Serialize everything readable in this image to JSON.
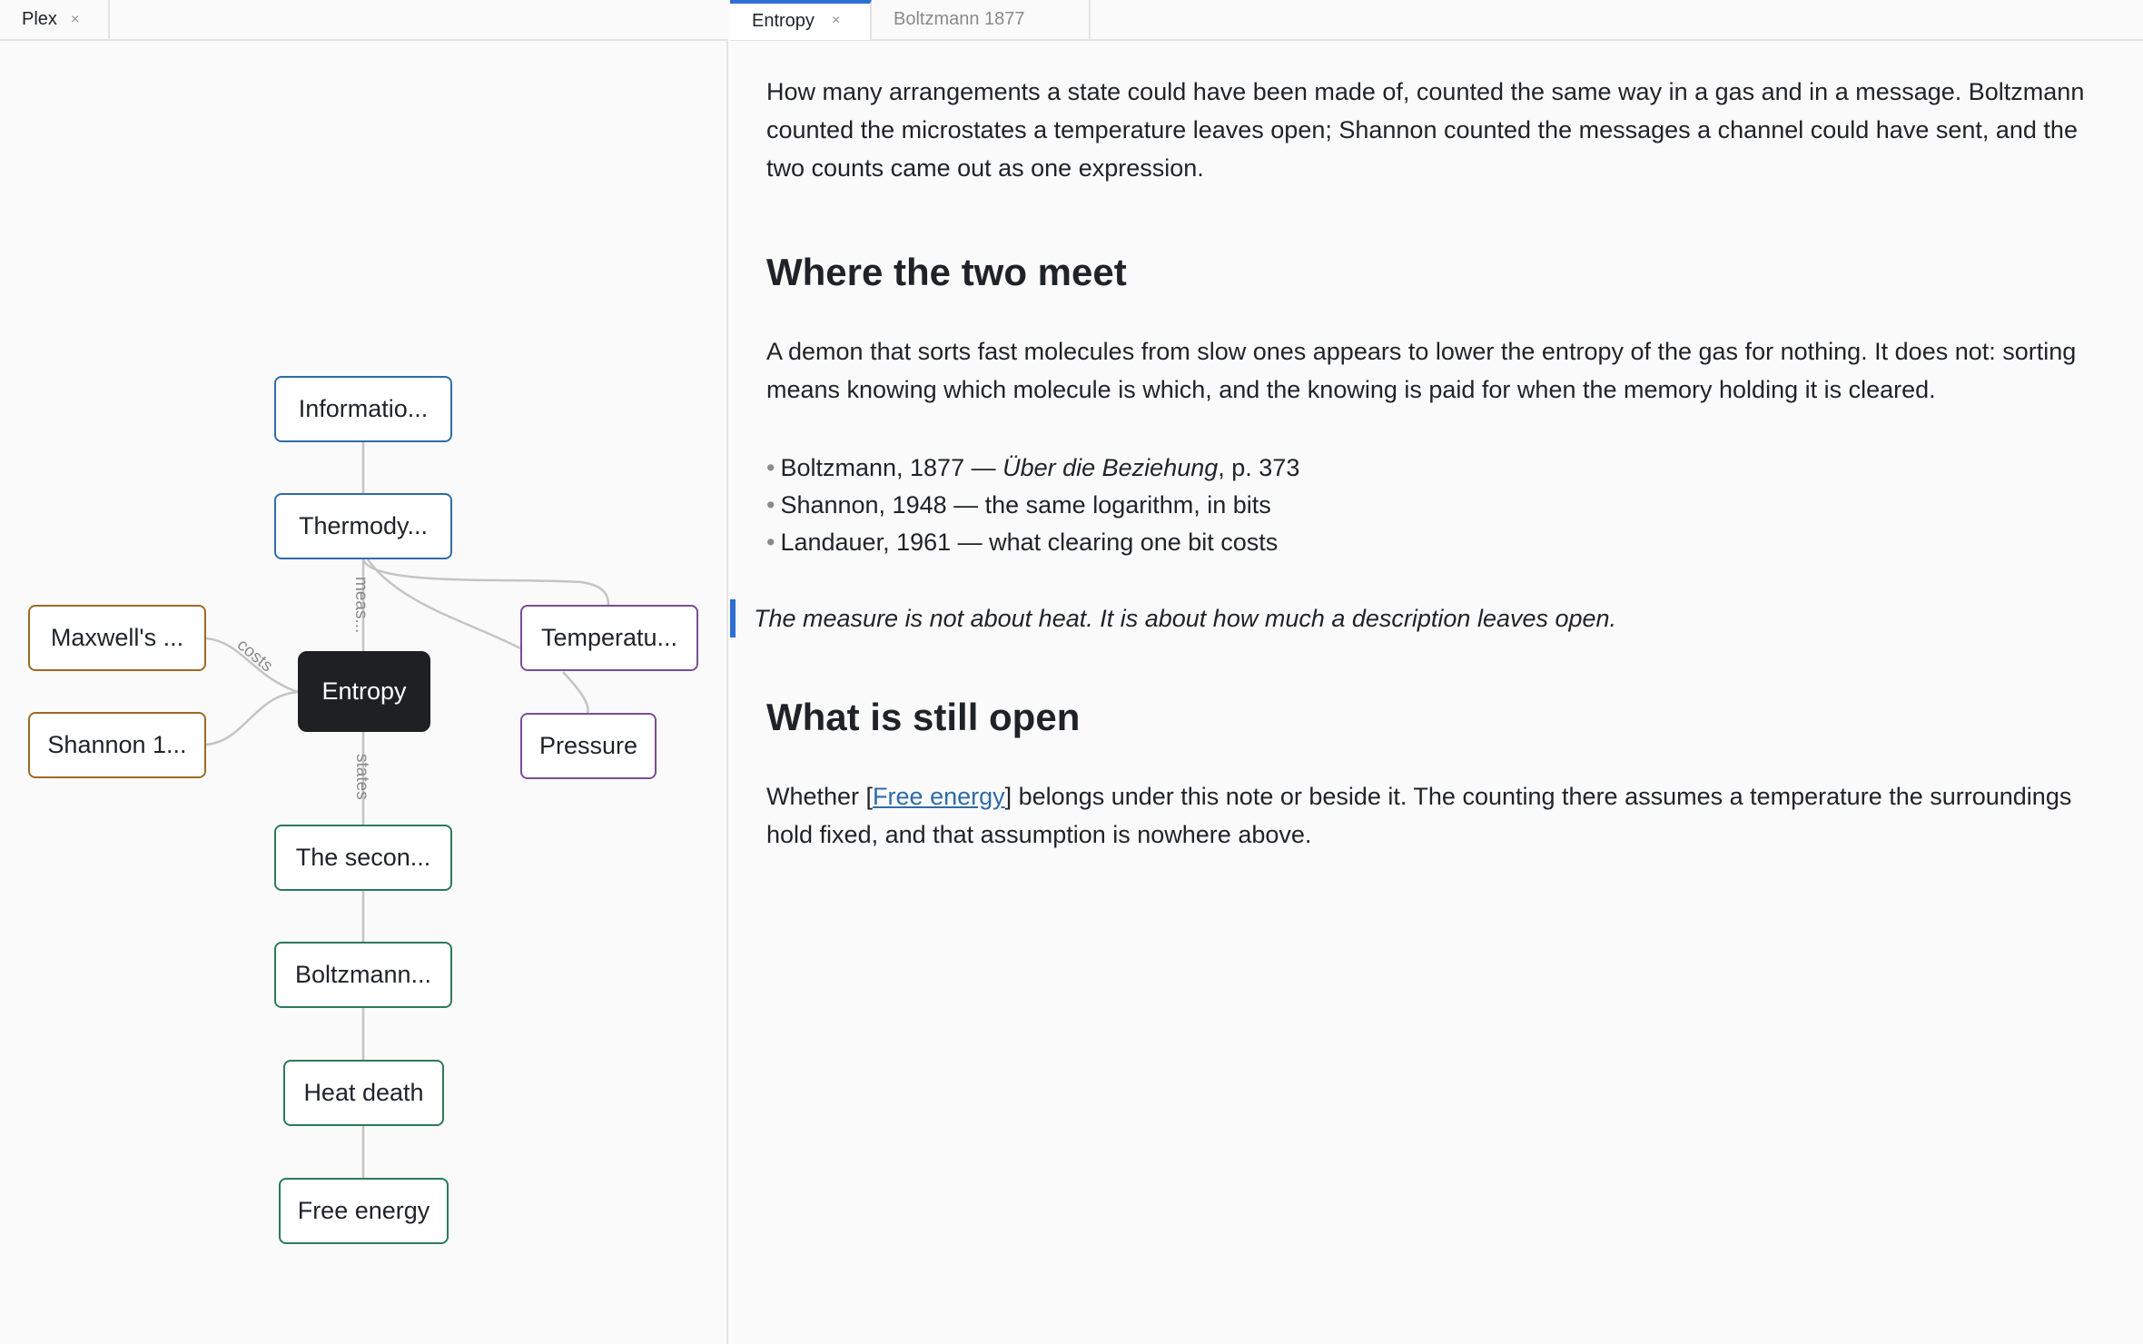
{
  "left_tabs": [
    {
      "label": "Plex",
      "close": "×"
    }
  ],
  "right_tabs": [
    {
      "label": "Entropy",
      "close": "×",
      "active": true
    },
    {
      "label": "Boltzmann 1877",
      "active": false
    }
  ],
  "graph": {
    "center": "Entropy",
    "nodes": {
      "information": "Informatio...",
      "thermodynamics": "Thermody...",
      "maxwell": "Maxwell's ...",
      "shannon": "Shannon 1...",
      "temperature": "Temperatu...",
      "pressure": "Pressure",
      "second_law": "The secon...",
      "boltzmann": "Boltzmann...",
      "heat_death": "Heat death",
      "free_energy": "Free energy"
    },
    "edge_labels": {
      "measures": "meas...",
      "costs": "costs",
      "states": "states"
    },
    "colors": {
      "blue": "#2e6ca8",
      "purple": "#7a4d96",
      "brown": "#9c6a22",
      "green": "#2c7a57",
      "center": "#1f2023",
      "accent": "#2f6fd1"
    }
  },
  "note": {
    "intro": "How many arrangements a state could have been made of, counted the same way in a gas and in a message. Boltzmann counted the microstates a temperature leaves open; Shannon counted the messages a channel could have sent, and the two counts came out as one expression.",
    "heading_meet": "Where the two meet",
    "para_demon": "A demon that sorts fast molecules from slow ones appears to lower the entropy of the gas for nothing. It does not: sorting means knowing which molecule is which, and the knowing is paid for when the memory holding it is cleared.",
    "refs": [
      {
        "lead": "Boltzmann, 1877 — ",
        "title": "Über die Beziehung",
        "tail": ", p. 373"
      },
      {
        "lead": "Shannon, 1948 — the same logarithm, in bits"
      },
      {
        "lead": "Landauer, 1961 — what clearing one bit costs"
      }
    ],
    "bullet": "•",
    "quote": "The measure is not about heat. It is about how much a description leaves open.",
    "heading_open": "What is still open",
    "para_open_before": "Whether [",
    "para_open_link": "Free energy",
    "para_open_after": "] belongs under this note or beside it. The counting there assumes a temperature the surroundings hold fixed, and that assumption is nowhere above."
  }
}
